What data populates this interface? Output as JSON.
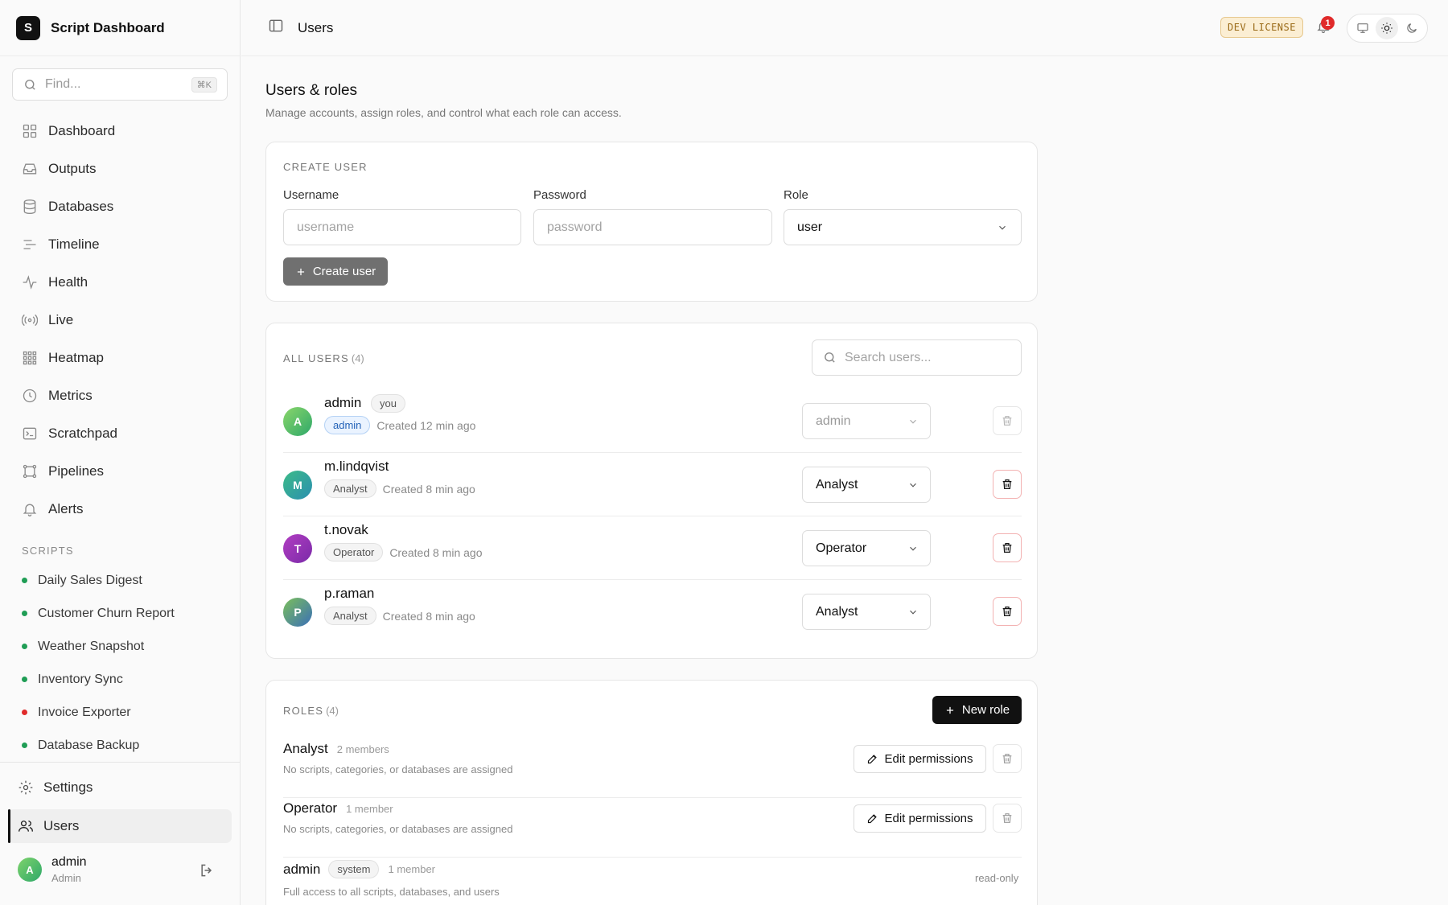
{
  "app": {
    "logo_letter": "S",
    "title": "Script Dashboard"
  },
  "search": {
    "placeholder": "Find...",
    "shortcut": "⌘K"
  },
  "nav": [
    {
      "label": "Dashboard",
      "icon": "grid-icon"
    },
    {
      "label": "Outputs",
      "icon": "inbox-icon"
    },
    {
      "label": "Databases",
      "icon": "database-icon"
    },
    {
      "label": "Timeline",
      "icon": "timeline-icon"
    },
    {
      "label": "Health",
      "icon": "pulse-icon"
    },
    {
      "label": "Live",
      "icon": "broadcast-icon"
    },
    {
      "label": "Heatmap",
      "icon": "heatmap-icon"
    },
    {
      "label": "Metrics",
      "icon": "clock-icon"
    },
    {
      "label": "Scratchpad",
      "icon": "terminal-icon"
    },
    {
      "label": "Pipelines",
      "icon": "pipeline-icon"
    },
    {
      "label": "Alerts",
      "icon": "bell-icon"
    }
  ],
  "scripts_section": {
    "label": "SCRIPTS",
    "items": [
      {
        "label": "Daily Sales Digest",
        "status_color": "#1f9d55"
      },
      {
        "label": "Customer Churn Report",
        "status_color": "#1f9d55"
      },
      {
        "label": "Weather Snapshot",
        "status_color": "#1f9d55"
      },
      {
        "label": "Inventory Sync",
        "status_color": "#1f9d55"
      },
      {
        "label": "Invoice Exporter",
        "status_color": "#e02a2a"
      },
      {
        "label": "Database Backup",
        "status_color": "#1f9d55"
      }
    ]
  },
  "bottom_nav": {
    "settings": "Settings",
    "users": "Users"
  },
  "profile": {
    "initial": "A",
    "name": "admin",
    "role": "Admin"
  },
  "topbar": {
    "title": "Users",
    "license_badge": "DEV LICENSE",
    "notification_count": "1"
  },
  "page": {
    "title": "Users & roles",
    "subtitle": "Manage accounts, assign roles, and control what each role can access."
  },
  "create_user": {
    "label": "CREATE USER",
    "username_label": "Username",
    "username_placeholder": "username",
    "password_label": "Password",
    "password_placeholder": "password",
    "role_label": "Role",
    "role_value": "user",
    "button": "Create user"
  },
  "all_users": {
    "label": "ALL USERS",
    "count": "(4)",
    "search_placeholder": "Search users...",
    "users": [
      {
        "initial": "A",
        "name": "admin",
        "you": "you",
        "badge": "admin",
        "created": "Created 12 min ago",
        "role": "admin"
      },
      {
        "initial": "M",
        "name": "m.lindqvist",
        "badge": "Analyst",
        "created": "Created 8 min ago",
        "role": "Analyst"
      },
      {
        "initial": "T",
        "name": "t.novak",
        "badge": "Operator",
        "created": "Created 8 min ago",
        "role": "Operator"
      },
      {
        "initial": "P",
        "name": "p.raman",
        "badge": "Analyst",
        "created": "Created 8 min ago",
        "role": "Analyst"
      }
    ]
  },
  "roles": {
    "label": "ROLES",
    "count": "(4)",
    "new_button": "New role",
    "edit_label": "Edit permissions",
    "items": [
      {
        "name": "Analyst",
        "members": "2 members",
        "desc": "No scripts, categories, or databases are assigned"
      },
      {
        "name": "Operator",
        "members": "1 member",
        "desc": "No scripts, categories, or databases are assigned"
      },
      {
        "name": "admin",
        "tag": "system",
        "members": "1 member",
        "desc": "Full access to all scripts, databases, and users",
        "status": "read-only"
      }
    ]
  }
}
